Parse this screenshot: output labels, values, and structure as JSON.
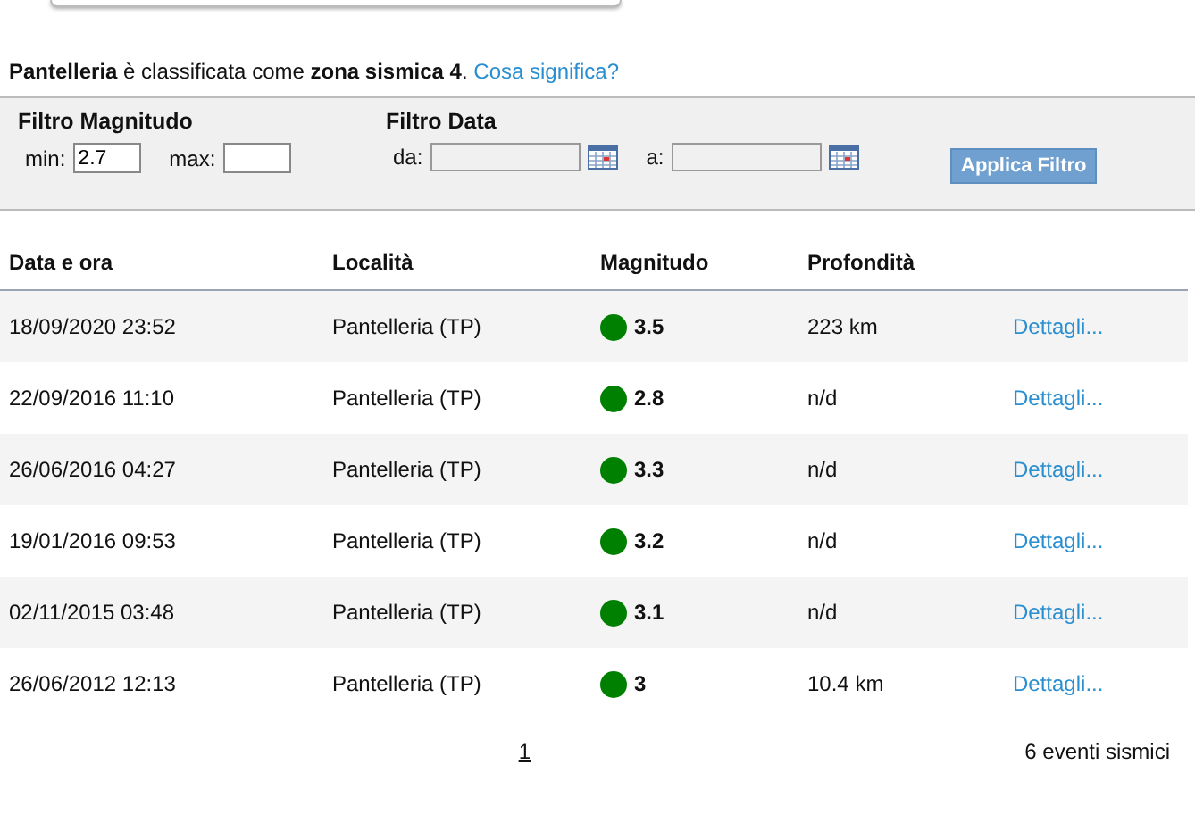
{
  "intro": {
    "text": "**Pantelleria** è classificata come **zona sismica 4**.",
    "link": "Cosa significa?"
  },
  "filter": {
    "magnitude": {
      "title": "Filtro Magnitudo",
      "min_label": "min:",
      "min_value": "2.7",
      "max_label": "max:"
    },
    "date": {
      "title": "Filtro Data",
      "from_label": "da:",
      "to_label": "a:"
    },
    "button": "Applica Filtro"
  },
  "table": {
    "columns": [
      "Data e ora",
      "Località",
      "Magnitudo",
      "Profondità"
    ],
    "rows": [
      {
        "date": "18/09/2020 23:52",
        "place": "Pantelleria (TP)",
        "magnitude": "3.5",
        "color": "#008000",
        "depth": "223 km",
        "link": "Dettagli..."
      },
      {
        "date": "22/09/2016 11:10",
        "place": "Pantelleria (TP)",
        "magnitude": "2.8",
        "color": "#008000",
        "depth": "n/d",
        "link": "Dettagli..."
      },
      {
        "date": "26/06/2016 04:27",
        "place": "Pantelleria (TP)",
        "magnitude": "3.3",
        "color": "#008000",
        "depth": "n/d",
        "link": "Dettagli..."
      },
      {
        "date": "19/01/2016 09:53",
        "place": "Pantelleria (TP)",
        "magnitude": "3.2",
        "color": "#008000",
        "depth": "n/d",
        "link": "Dettagli..."
      },
      {
        "date": "02/11/2015 03:48",
        "place": "Pantelleria (TP)",
        "magnitude": "3.1",
        "color": "#008000",
        "depth": "n/d",
        "link": "Dettagli..."
      },
      {
        "date": "26/06/2012 12:13",
        "place": "Pantelleria (TP)",
        "magnitude": "3",
        "color": "#008000",
        "depth": "10.4 km",
        "link": "Dettagli..."
      }
    ]
  },
  "pagination": {
    "pages": [
      {
        "label": "1",
        "selected": true
      }
    ],
    "count": "6 eventi sismici"
  }
}
